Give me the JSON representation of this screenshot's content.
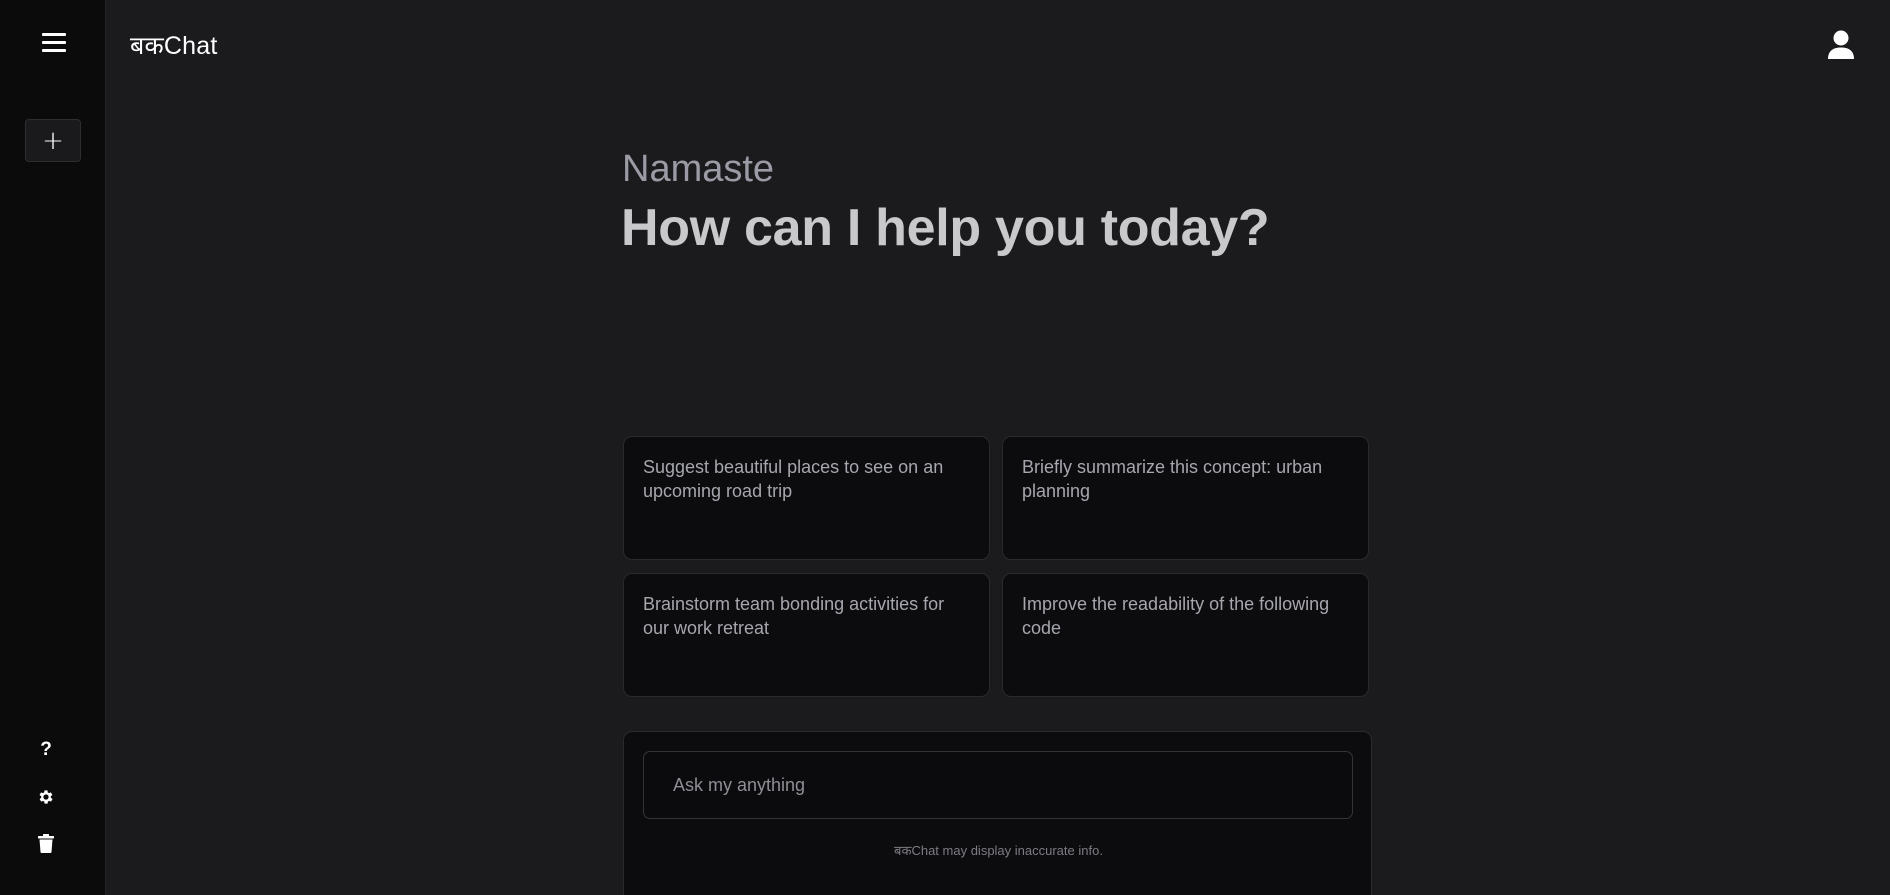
{
  "app": {
    "brand": "बकChat"
  },
  "sidebar": {
    "menu_icon": "hamburger-menu-icon",
    "new_chat_label": "+",
    "help_label": "?",
    "settings_icon": "gear-icon",
    "delete_icon": "trash-icon"
  },
  "header": {
    "user_icon": "user-icon"
  },
  "main": {
    "greeting": "Namaste",
    "headline": "How can I help you today?",
    "suggestions": [
      "Suggest beautiful places to see on an upcoming road trip",
      "Briefly summarize this concept: urban planning",
      "Brainstorm team bonding activities for our work retreat",
      "Improve the readability of the following code"
    ]
  },
  "composer": {
    "placeholder": "Ask my anything",
    "value": "",
    "disclaimer": "बकChat may display inaccurate info."
  },
  "colors": {
    "background": "#1b1b1d",
    "sidebar": "#0b0b0c",
    "card": "#0c0c0e",
    "greeting": "#9a9ba5",
    "headline": "#c9c9cc"
  }
}
